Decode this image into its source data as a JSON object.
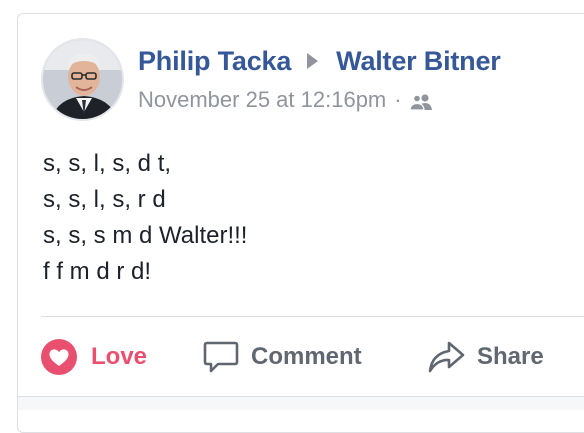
{
  "post": {
    "author": "Philip Tacka",
    "recipient": "Walter Bitner",
    "timestamp": "November 25 at 12:16pm",
    "separator": "·",
    "audience_icon": "friends-icon",
    "body_lines": [
      "s, s, l, s, d t,",
      "s, s, l, s, r d",
      "s, s, s m d Walter!!!",
      "f f m d r d!"
    ]
  },
  "actions": {
    "love": "Love",
    "comment": "Comment",
    "share": "Share"
  },
  "colors": {
    "link": "#365899",
    "meta": "#90949c",
    "love": "#e9506f",
    "action_text": "#606770"
  }
}
